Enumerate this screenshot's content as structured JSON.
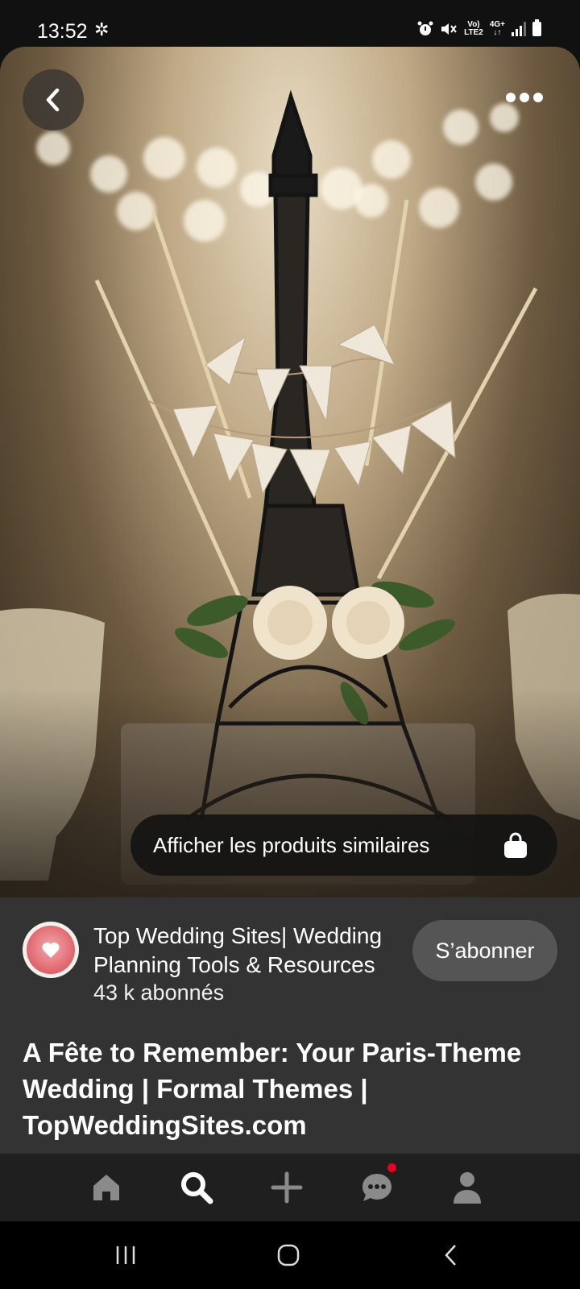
{
  "status_bar": {
    "time": "13:52",
    "network_top": "Vo)",
    "network_bottom": "LTE2",
    "data_top": "4G+",
    "data_bottom": "↓↑"
  },
  "pin": {
    "image_alt": "Eiffel tower centerpiece with Just Married banner",
    "similar_products_label": "Afficher les produits similaires",
    "title": "A Fête to Remember: Your Paris-Theme Wedding | Formal Themes | TopWeddingSites.com"
  },
  "creator": {
    "name": "Top Wedding Sites| Wedding Planning Tools & Resources",
    "followers": "43 k abonnés",
    "subscribe_label": "S’abonner"
  },
  "bottom_nav": {
    "items": [
      "home-icon",
      "search-icon",
      "add-icon",
      "messages-icon",
      "profile-icon"
    ],
    "messages_has_notification": true
  },
  "colors": {
    "notification": "#e60023",
    "info_background": "#333333",
    "subscribe_button": "#555555"
  }
}
